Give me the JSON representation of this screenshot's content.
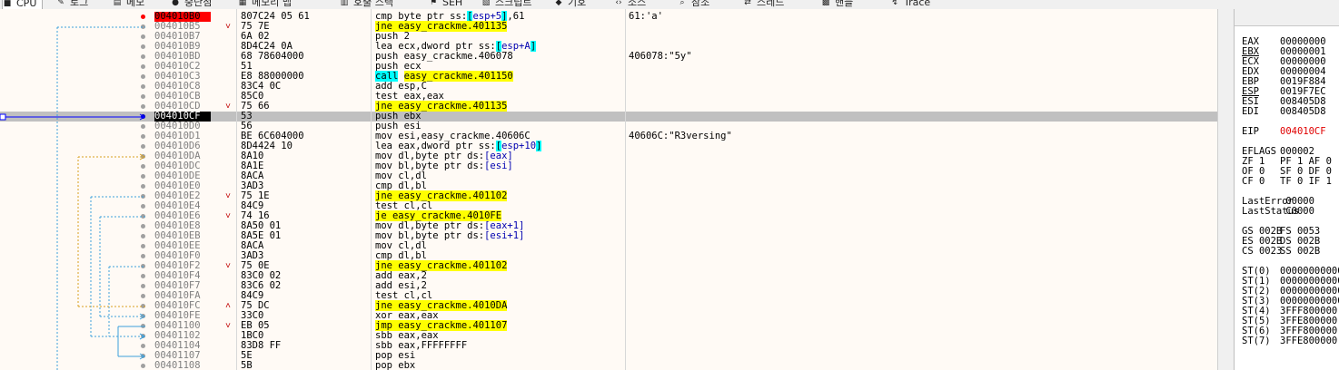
{
  "tabs": [
    {
      "icon": "cpu-icon",
      "glyph": "■",
      "label": "CPU",
      "active": true
    },
    {
      "icon": "log-icon",
      "glyph": "✎",
      "label": "로그"
    },
    {
      "icon": "notes-icon",
      "glyph": "▤",
      "label": "메모"
    },
    {
      "icon": "breakpoint-icon",
      "glyph": "●",
      "label": "중단점"
    },
    {
      "icon": "memory-map-icon",
      "glyph": "▦",
      "label": "메모리 맵"
    },
    {
      "icon": "call-stack-icon",
      "glyph": "▥",
      "label": "호출 스택"
    },
    {
      "icon": "seh-icon",
      "glyph": "⚑",
      "label": "SEH"
    },
    {
      "icon": "script-icon",
      "glyph": "▧",
      "label": "스크립트"
    },
    {
      "icon": "symbols-icon",
      "glyph": "◆",
      "label": "기호"
    },
    {
      "icon": "source-icon",
      "glyph": "‹›",
      "label": "소스"
    },
    {
      "icon": "references-icon",
      "glyph": "⌕",
      "label": "참조"
    },
    {
      "icon": "threads-icon",
      "glyph": "⇄",
      "label": "스레드"
    },
    {
      "icon": "handles-icon",
      "glyph": "▩",
      "label": "핸들"
    },
    {
      "icon": "trace-icon",
      "glyph": "↯",
      "label": "Trace"
    }
  ],
  "colors": {
    "breakpoint": "#ff0000",
    "highlight": "#ffff00",
    "call": "#00ffff",
    "eip_text": "#e00000",
    "arrow": "#0000ff"
  },
  "rows": [
    {
      "addr": "004010B0",
      "bytes": "807C24 05 61",
      "mn": [
        {
          "t": "cmp byte ptr ss:"
        },
        {
          "t": "[",
          "c": "hlc"
        },
        {
          "t": "esp+5",
          "c": "blu"
        },
        {
          "t": "]",
          "c": "hlc"
        },
        {
          "t": ",61"
        }
      ],
      "cmt": "61:'a'",
      "state": "bp"
    },
    {
      "addr": "004010B5",
      "bytes": "75 7E",
      "mn": [
        {
          "t": "jne easy_crackme.401135",
          "c": "hl"
        }
      ],
      "cmt": "",
      "mark": "˅"
    },
    {
      "addr": "004010B7",
      "bytes": "6A 02",
      "mn": [
        {
          "t": "push 2"
        }
      ],
      "cmt": ""
    },
    {
      "addr": "004010B9",
      "bytes": "8D4C24 0A",
      "mn": [
        {
          "t": "lea ecx,dword ptr ss:"
        },
        {
          "t": "[",
          "c": "hlc"
        },
        {
          "t": "esp+A",
          "c": "blu"
        },
        {
          "t": "]",
          "c": "hlc"
        }
      ],
      "cmt": ""
    },
    {
      "addr": "004010BD",
      "bytes": "68 78604000",
      "mn": [
        {
          "t": "push easy_crackme.406078"
        }
      ],
      "cmt": "406078:\"5y\""
    },
    {
      "addr": "004010C2",
      "bytes": "51",
      "mn": [
        {
          "t": "push ecx"
        }
      ],
      "cmt": ""
    },
    {
      "addr": "004010C3",
      "bytes": "E8 88000000",
      "mn": [
        {
          "t": "call",
          "c": "hlc"
        },
        {
          "t": " "
        },
        {
          "t": "easy_crackme.401150",
          "c": "hl"
        }
      ],
      "cmt": ""
    },
    {
      "addr": "004010C8",
      "bytes": "83C4 0C",
      "mn": [
        {
          "t": "add esp,C"
        }
      ],
      "cmt": ""
    },
    {
      "addr": "004010CB",
      "bytes": "85C0",
      "mn": [
        {
          "t": "test eax,eax"
        }
      ],
      "cmt": ""
    },
    {
      "addr": "004010CD",
      "bytes": "75 66",
      "mn": [
        {
          "t": "jne easy_crackme.401135",
          "c": "hl"
        }
      ],
      "cmt": "",
      "mark": "˅"
    },
    {
      "addr": "004010CF",
      "bytes": "53",
      "mn": [
        {
          "t": "push ebx"
        }
      ],
      "cmt": "",
      "state": "eip"
    },
    {
      "addr": "004010D0",
      "bytes": "56",
      "mn": [
        {
          "t": "push esi"
        }
      ],
      "cmt": ""
    },
    {
      "addr": "004010D1",
      "bytes": "BE 6C604000",
      "mn": [
        {
          "t": "mov esi,easy_crackme.40606C"
        }
      ],
      "cmt": "40606C:\"R3versing\""
    },
    {
      "addr": "004010D6",
      "bytes": "8D4424 10",
      "mn": [
        {
          "t": "lea eax,dword ptr ss:"
        },
        {
          "t": "[",
          "c": "hlc"
        },
        {
          "t": "esp+10",
          "c": "blu"
        },
        {
          "t": "]",
          "c": "hlc"
        }
      ],
      "cmt": ""
    },
    {
      "addr": "004010DA",
      "bytes": "8A10",
      "mn": [
        {
          "t": "mov dl,byte ptr ds:"
        },
        {
          "t": "[eax]",
          "c": "blu"
        }
      ],
      "cmt": ""
    },
    {
      "addr": "004010DC",
      "bytes": "8A1E",
      "mn": [
        {
          "t": "mov bl,byte ptr ds:"
        },
        {
          "t": "[esi]",
          "c": "blu"
        }
      ],
      "cmt": ""
    },
    {
      "addr": "004010DE",
      "bytes": "8ACA",
      "mn": [
        {
          "t": "mov cl,dl"
        }
      ],
      "cmt": ""
    },
    {
      "addr": "004010E0",
      "bytes": "3AD3",
      "mn": [
        {
          "t": "cmp dl,bl"
        }
      ],
      "cmt": ""
    },
    {
      "addr": "004010E2",
      "bytes": "75 1E",
      "mn": [
        {
          "t": "jne easy_crackme.401102",
          "c": "hl"
        }
      ],
      "cmt": "",
      "mark": "˅"
    },
    {
      "addr": "004010E4",
      "bytes": "84C9",
      "mn": [
        {
          "t": "test cl,cl"
        }
      ],
      "cmt": ""
    },
    {
      "addr": "004010E6",
      "bytes": "74 16",
      "mn": [
        {
          "t": "je easy_crackme.4010FE",
          "c": "hl"
        }
      ],
      "cmt": "",
      "mark": "˅"
    },
    {
      "addr": "004010E8",
      "bytes": "8A50 01",
      "mn": [
        {
          "t": "mov dl,byte ptr ds:"
        },
        {
          "t": "[eax+1]",
          "c": "blu"
        }
      ],
      "cmt": ""
    },
    {
      "addr": "004010EB",
      "bytes": "8A5E 01",
      "mn": [
        {
          "t": "mov bl,byte ptr ds:"
        },
        {
          "t": "[esi+1]",
          "c": "blu"
        }
      ],
      "cmt": ""
    },
    {
      "addr": "004010EE",
      "bytes": "8ACA",
      "mn": [
        {
          "t": "mov cl,dl"
        }
      ],
      "cmt": ""
    },
    {
      "addr": "004010F0",
      "bytes": "3AD3",
      "mn": [
        {
          "t": "cmp dl,bl"
        }
      ],
      "cmt": ""
    },
    {
      "addr": "004010F2",
      "bytes": "75 0E",
      "mn": [
        {
          "t": "jne easy_crackme.401102",
          "c": "hl"
        }
      ],
      "cmt": "",
      "mark": "˅"
    },
    {
      "addr": "004010F4",
      "bytes": "83C0 02",
      "mn": [
        {
          "t": "add eax,2"
        }
      ],
      "cmt": ""
    },
    {
      "addr": "004010F7",
      "bytes": "83C6 02",
      "mn": [
        {
          "t": "add esi,2"
        }
      ],
      "cmt": ""
    },
    {
      "addr": "004010FA",
      "bytes": "84C9",
      "mn": [
        {
          "t": "test cl,cl"
        }
      ],
      "cmt": ""
    },
    {
      "addr": "004010FC",
      "bytes": "75 DC",
      "mn": [
        {
          "t": "jne easy_crackme.4010DA",
          "c": "hl"
        }
      ],
      "cmt": "",
      "mark": "˄"
    },
    {
      "addr": "004010FE",
      "bytes": "33C0",
      "mn": [
        {
          "t": "xor eax,eax"
        }
      ],
      "cmt": ""
    },
    {
      "addr": "00401100",
      "bytes": "EB 05",
      "mn": [
        {
          "t": "jmp easy_crackme.401107",
          "c": "hl"
        }
      ],
      "cmt": "",
      "mark": "˅"
    },
    {
      "addr": "00401102",
      "bytes": "1BC0",
      "mn": [
        {
          "t": "sbb eax,eax"
        }
      ],
      "cmt": ""
    },
    {
      "addr": "00401104",
      "bytes": "83D8 FF",
      "mn": [
        {
          "t": "sbb eax,FFFFFFFF"
        }
      ],
      "cmt": ""
    },
    {
      "addr": "00401107",
      "bytes": "5E",
      "mn": [
        {
          "t": "pop esi"
        }
      ],
      "cmt": ""
    },
    {
      "addr": "00401108",
      "bytes": "5B",
      "mn": [
        {
          "t": "pop ebx"
        }
      ],
      "cmt": ""
    }
  ],
  "registers": [
    {
      "n": "EAX",
      "v": "00000000"
    },
    {
      "n": "EBX",
      "v": "00000001",
      "u": true
    },
    {
      "n": "ECX",
      "v": "00000000"
    },
    {
      "n": "EDX",
      "v": "00000004"
    },
    {
      "n": "EBP",
      "v": "0019F884"
    },
    {
      "n": "ESP",
      "v": "0019F7EC",
      "u": true
    },
    {
      "n": "ESI",
      "v": "008405D8"
    },
    {
      "n": "EDI",
      "v": "008405D8"
    },
    {
      "n": "",
      "v": ""
    },
    {
      "n": "EIP",
      "v": "004010CF",
      "red": true
    },
    {
      "n": "",
      "v": ""
    },
    {
      "n": "EFLAGS",
      "v": "000002"
    },
    {
      "n": "ZF 1",
      "v": "PF 1  AF 0"
    },
    {
      "n": "OF 0",
      "v": "SF 0  DF 0"
    },
    {
      "n": "CF 0",
      "v": "TF 0  IF 1"
    },
    {
      "n": "",
      "v": ""
    },
    {
      "n": "LastError",
      "v": " 00000"
    },
    {
      "n": "LastStatus",
      "v": " C0000"
    },
    {
      "n": "",
      "v": ""
    },
    {
      "n": "GS 002B",
      "v": "FS 0053"
    },
    {
      "n": "ES 002B",
      "v": "DS 002B"
    },
    {
      "n": "CS 0023",
      "v": "SS 002B"
    },
    {
      "n": "",
      "v": ""
    },
    {
      "n": "ST(0)",
      "v": "00000000000"
    },
    {
      "n": "ST(1)",
      "v": "00000000000"
    },
    {
      "n": "ST(2)",
      "v": "00000000000"
    },
    {
      "n": "ST(3)",
      "v": "00000000000"
    },
    {
      "n": "ST(4)",
      "v": "3FFF800000"
    },
    {
      "n": "ST(5)",
      "v": "3FFE800000"
    },
    {
      "n": "ST(6)",
      "v": "3FFF800000"
    },
    {
      "n": "ST(7)",
      "v": "3FFE800000"
    }
  ]
}
